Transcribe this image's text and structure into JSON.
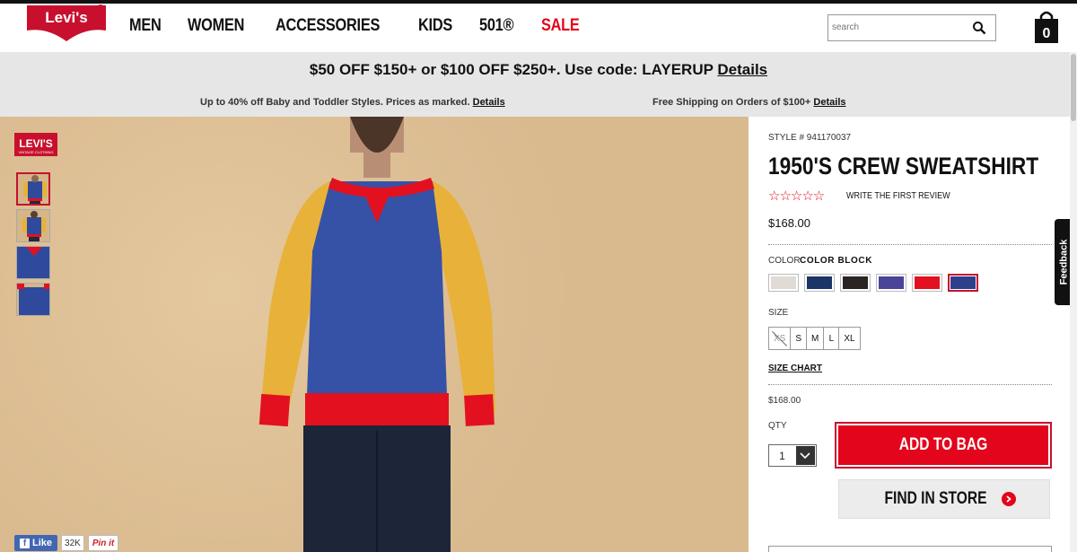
{
  "header": {
    "logo_text": "Levi's",
    "nav": [
      "MEN",
      "WOMEN",
      "ACCESSORIES",
      "KIDS",
      "501®",
      "SALE"
    ],
    "search_placeholder": "search",
    "bag_count": "0"
  },
  "promo": {
    "main_text": "$50 OFF $150+ or $100 OFF $250+. Use code: LAYERUP",
    "main_link": "Details",
    "left_text": "Up to 40% off Baby and Toddler Styles. Prices as marked.",
    "left_link": "Details",
    "right_text": "Free Shipping on Orders of $100+",
    "right_link": "Details"
  },
  "gallery": {
    "brand_logo_text": "LEVI'S VINTAGE CLOTHING",
    "thumb_count": 4,
    "social": {
      "like_label": "Like",
      "like_count": "32K",
      "pin_label": "Pin it"
    }
  },
  "product": {
    "style": "STYLE # 941170037",
    "title": "1950'S CREW SWEATSHIRT",
    "stars": "☆☆☆☆☆",
    "review_link": "WRITE THE FIRST REVIEW",
    "price": "$168.00",
    "color_label": "COLOR",
    "color_name": "COLOR BLOCK",
    "swatches": [
      "#e0dcd5",
      "#1b3566",
      "#2a2422",
      "#4a4598",
      "#e3101f",
      "#2f3f8c"
    ],
    "size_label": "SIZE",
    "sizes": [
      "XS",
      "S",
      "M",
      "L",
      "XL"
    ],
    "size_chart": "SIZE CHART",
    "price_small": "$168.00",
    "qty_label": "QTY",
    "qty_value": "1",
    "add_to_bag": "ADD TO BAG",
    "find_in_store": "FIND IN STORE"
  },
  "feedback": "Feedback",
  "colors": {
    "brand_red": "#e3051b",
    "promo_bg": "#e6e6e6"
  }
}
